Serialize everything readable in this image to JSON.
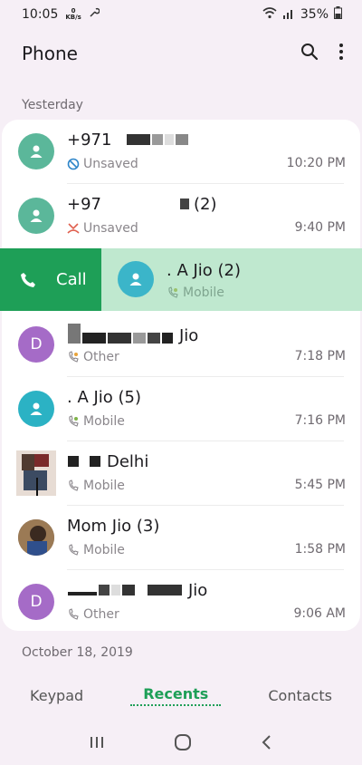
{
  "status": {
    "time": "10:05",
    "kb_top": "KB/s",
    "kb_bottom": "0",
    "battery": "35%"
  },
  "header": {
    "title": "Phone"
  },
  "sections": {
    "yesterday": "Yesterday",
    "older": "October 18, 2019"
  },
  "swipe": {
    "call_label": "Call"
  },
  "calls": [
    {
      "initial": "",
      "name": "+971",
      "suffix": "",
      "type": "Unsaved",
      "time": "10:20 PM",
      "color": "#5bb79a"
    },
    {
      "initial": "",
      "name": "+97",
      "suffix": "(2)",
      "type": "Unsaved",
      "time": "9:40 PM",
      "color": "#5bb79a"
    },
    {
      "initial": "",
      "name": ". A Jio (2)",
      "suffix": "",
      "type": "Mobile",
      "time": "",
      "color": "#3bb5c9"
    },
    {
      "initial": "D",
      "name": "",
      "suffix": "Jio",
      "type": "Other",
      "time": "7:18 PM",
      "color": "#a56bc7"
    },
    {
      "initial": "",
      "name": ". A Jio (5)",
      "suffix": "",
      "type": "Mobile",
      "time": "7:16 PM",
      "color": "#2bb2c4"
    },
    {
      "initial": "",
      "name": "",
      "suffix": "Delhi",
      "type": "Mobile",
      "time": "5:45 PM",
      "color": "#4a4a4a"
    },
    {
      "initial": "",
      "name": "Mom Jio (3)",
      "suffix": "",
      "type": "Mobile",
      "time": "1:58 PM",
      "color": "#6a5040"
    },
    {
      "initial": "D",
      "name": "",
      "suffix": "Jio",
      "type": "Other",
      "time": "9:06 AM",
      "color": "#a56bc7"
    }
  ],
  "nav": {
    "keypad": "Keypad",
    "recents": "Recents",
    "contacts": "Contacts"
  },
  "colors": {
    "accent": "#1e9f57",
    "swipe_bg": "#bfe8cf"
  }
}
